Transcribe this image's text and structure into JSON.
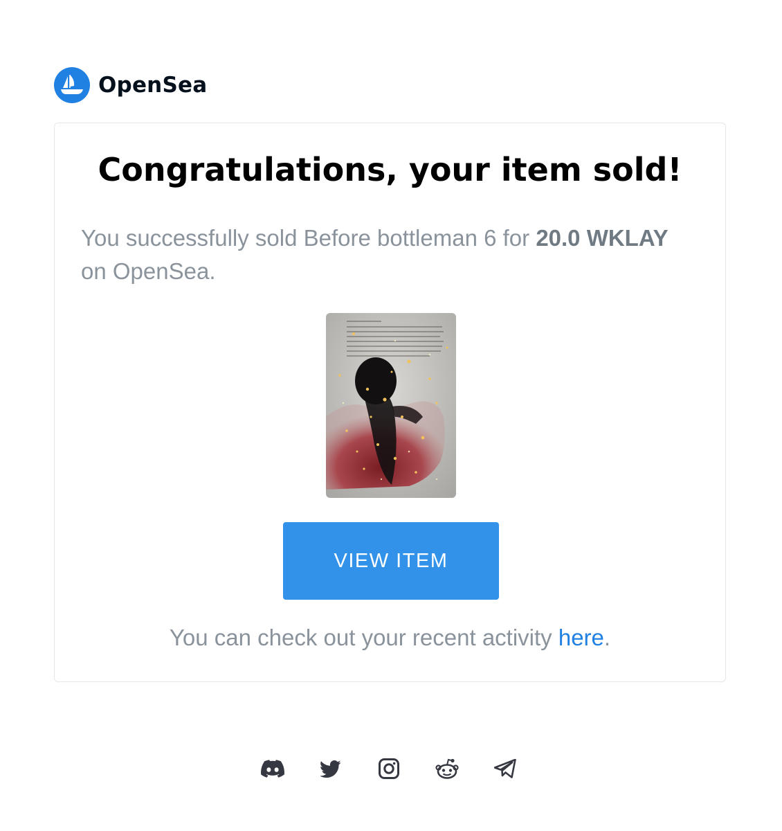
{
  "brand": {
    "name": "OpenSea",
    "color": "#2081e2",
    "icon": "opensea-ship-icon"
  },
  "email": {
    "headline": "Congratulations, your item sold!",
    "message_prefix": "You successfully sold Before bottleman 6 for ",
    "price": "20.0 WKLAY",
    "message_suffix": " on OpenSea.",
    "item_image": "artwork-thumbnail",
    "button_label": "VIEW ITEM",
    "button_color": "#3291e9",
    "activity_prefix": "You can check out your recent activity ",
    "activity_link": "here",
    "activity_suffix": "."
  },
  "footer": {
    "socials": [
      {
        "name": "discord-icon"
      },
      {
        "name": "twitter-icon"
      },
      {
        "name": "instagram-icon"
      },
      {
        "name": "reddit-icon"
      },
      {
        "name": "telegram-icon"
      }
    ]
  }
}
